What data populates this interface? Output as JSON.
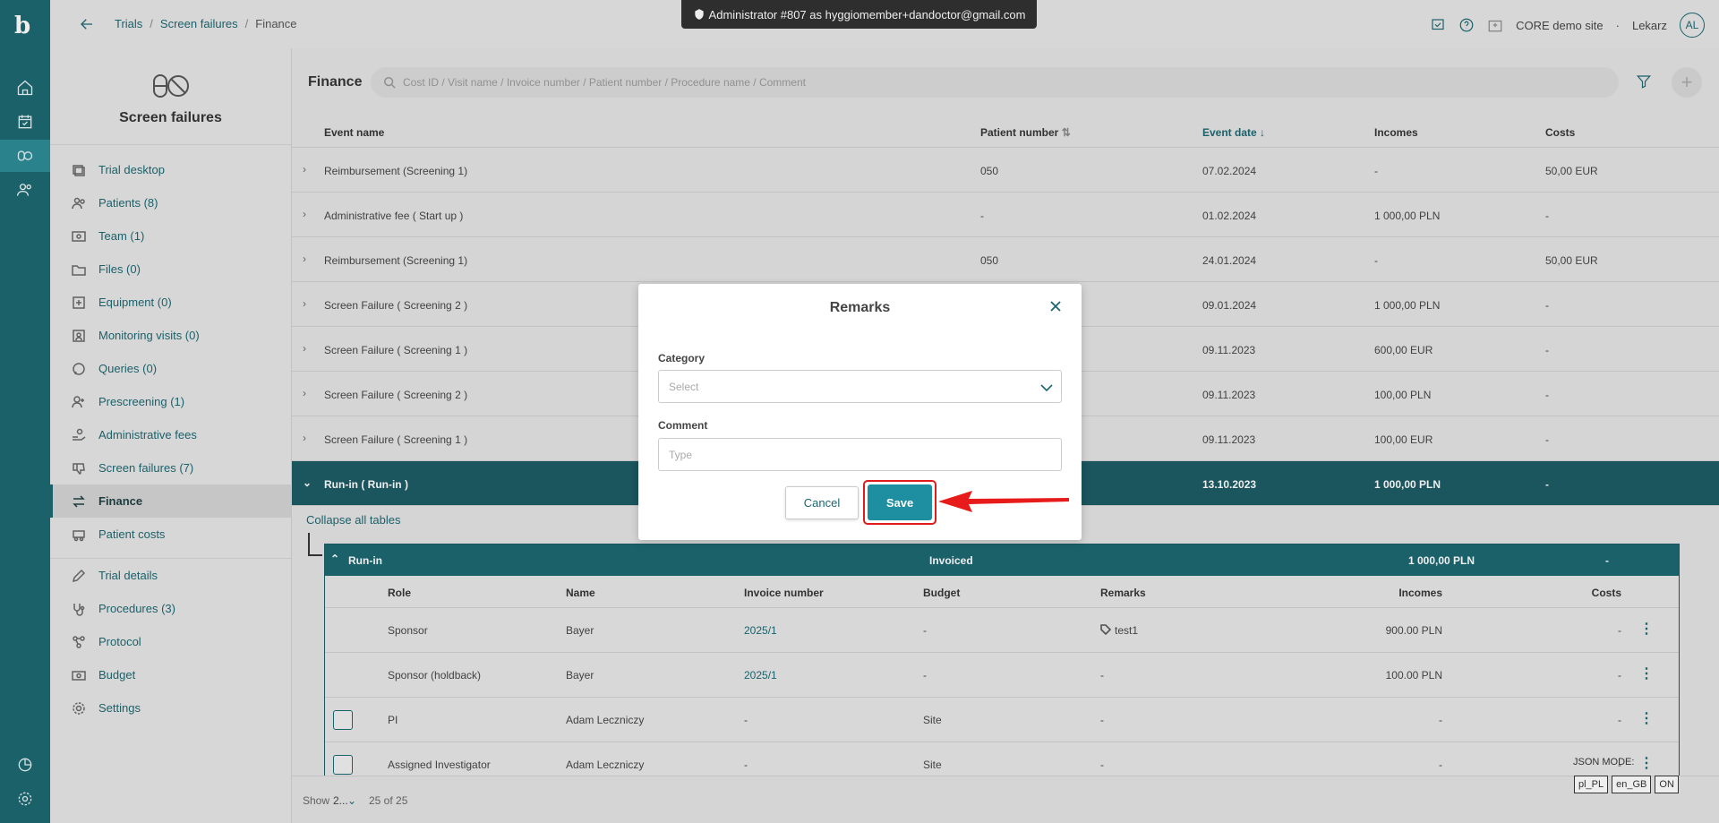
{
  "header": {
    "breadcrumbs": [
      "Trials",
      "Screen failures",
      "Finance"
    ],
    "admin_banner": "Administrator #807 as hyggiomember+dandoctor@gmail.com",
    "site_name": "CORE demo site",
    "role": "Lekarz",
    "avatar_initials": "AL"
  },
  "sidebar": {
    "title": "Screen failures",
    "items": [
      {
        "label": "Trial desktop",
        "icon": "desktop-icon"
      },
      {
        "label": "Patients (8)",
        "icon": "patients-icon"
      },
      {
        "label": "Team (1)",
        "icon": "team-icon"
      },
      {
        "label": "Files (0)",
        "icon": "folder-icon"
      },
      {
        "label": "Equipment (0)",
        "icon": "equipment-icon"
      },
      {
        "label": "Monitoring visits (0)",
        "icon": "monitoring-icon"
      },
      {
        "label": "Queries (0)",
        "icon": "chat-icon"
      },
      {
        "label": "Prescreening (1)",
        "icon": "user-add-icon"
      },
      {
        "label": "Administrative fees",
        "icon": "hand-coin-icon"
      },
      {
        "label": "Screen failures (7)",
        "icon": "thumb-down-icon"
      },
      {
        "label": "Finance",
        "icon": "swap-icon"
      },
      {
        "label": "Patient costs",
        "icon": "car-icon"
      },
      {
        "label": "Trial details",
        "icon": "pencil-icon"
      },
      {
        "label": "Procedures (3)",
        "icon": "stethoscope-icon"
      },
      {
        "label": "Protocol",
        "icon": "protocol-icon"
      },
      {
        "label": "Budget",
        "icon": "money-icon"
      },
      {
        "label": "Settings",
        "icon": "gear-icon"
      }
    ]
  },
  "finance": {
    "title": "Finance",
    "search_placeholder": "Cost ID / Visit name / Invoice number / Patient number / Procedure name / Comment",
    "columns": [
      "Event name",
      "Patient number",
      "Event date",
      "Incomes",
      "Costs"
    ],
    "rows": [
      [
        "Reimbursement (Screening 1)",
        "050",
        "07.02.2024",
        "-",
        "50,00 EUR"
      ],
      [
        "Administrative fee ( Start up )",
        "-",
        "01.02.2024",
        "1 000,00 PLN",
        "-"
      ],
      [
        "Reimbursement (Screening 1)",
        "050",
        "24.01.2024",
        "-",
        "50,00 EUR"
      ],
      [
        "Screen Failure ( Screening 2 )",
        "",
        "09.01.2024",
        "1 000,00 PLN",
        "-"
      ],
      [
        "Screen Failure ( Screening 1 )",
        "",
        "09.11.2023",
        "600,00 EUR",
        "-"
      ],
      [
        "Screen Failure ( Screening 2 )",
        "",
        "09.11.2023",
        "100,00 PLN",
        "-"
      ],
      [
        "Screen Failure ( Screening 1 )",
        "",
        "09.11.2023",
        "100,00 EUR",
        "-"
      ],
      [
        "Run-in ( Run-in )",
        "",
        "13.10.2023",
        "1 000,00 PLN",
        "-"
      ]
    ],
    "collapse_label": "Collapse all tables",
    "sub": {
      "name": "Run-in",
      "status": "Invoiced",
      "incomes": "1 000,00 PLN",
      "costs": "-",
      "columns": [
        "Role",
        "Name",
        "Invoice number",
        "Budget",
        "Remarks",
        "Incomes",
        "Costs"
      ],
      "rows": [
        [
          "Sponsor",
          "Bayer",
          "2025/1",
          "-",
          "test1",
          "900.00 PLN",
          "-"
        ],
        [
          "Sponsor (holdback)",
          "Bayer",
          "2025/1",
          "-",
          "-",
          "100.00 PLN",
          "-"
        ],
        [
          "PI",
          "Adam Leczniczy",
          "-",
          "Site",
          "-",
          "-",
          "-"
        ],
        [
          "Assigned Investigator",
          "Adam Leczniczy",
          "-",
          "Site",
          "-",
          "-",
          "-"
        ]
      ]
    },
    "pager": {
      "show_label": "Show",
      "page_size": "2...",
      "count": "25 of 25"
    }
  },
  "json_mode": {
    "label": "JSON MODE:",
    "buttons": [
      "pl_PL",
      "en_GB",
      "ON"
    ]
  },
  "modal": {
    "title": "Remarks",
    "category_label": "Category",
    "category_placeholder": "Select",
    "comment_label": "Comment",
    "comment_placeholder": "Type",
    "cancel_label": "Cancel",
    "save_label": "Save"
  },
  "colors": {
    "primary": "#1b6670",
    "accent": "#1d8fa0",
    "highlight": "#e01b1b"
  }
}
